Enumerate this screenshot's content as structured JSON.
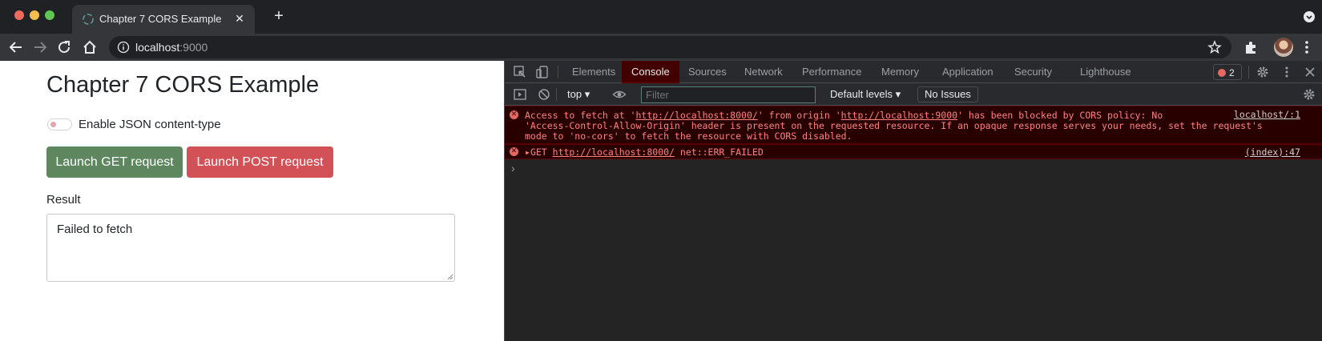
{
  "browser": {
    "tab_title": "Chapter 7 CORS Example",
    "url_host": "localhost",
    "url_port": ":9000"
  },
  "page": {
    "title": "Chapter 7 CORS Example",
    "toggle_label": "Enable JSON content-type",
    "toggle_on": false,
    "get_button": "Launch GET request",
    "post_button": "Launch POST request",
    "result_label": "Result",
    "result_value": "Failed to fetch",
    "colors": {
      "get": "#5e8760",
      "post": "#d25157"
    }
  },
  "devtools": {
    "tabs": [
      "Elements",
      "Console",
      "Sources",
      "Network",
      "Performance",
      "Memory",
      "Application",
      "Security",
      "Lighthouse"
    ],
    "active_tab": "Console",
    "error_count": "2",
    "context": "top",
    "filter_placeholder": "Filter",
    "levels": "Default levels",
    "issues": "No Issues",
    "logs": [
      {
        "line1_pre": "Access to fetch at '",
        "line1_url1": "http://localhost:8000/",
        "line1_mid": "' from origin '",
        "line1_url2": "http://localhost:9000",
        "line1_post": "' has been blocked by CORS policy: No",
        "line2": "'Access-Control-Allow-Origin' header is present on the requested resource. If an opaque response serves your needs, set the request's",
        "line3": "mode to 'no-cors' to fetch the resource with CORS disabled.",
        "source": "localhost/:1"
      },
      {
        "method": "GET",
        "url": "http://localhost:8000/",
        "error": "net::ERR_FAILED",
        "source": "(index):47"
      }
    ]
  }
}
